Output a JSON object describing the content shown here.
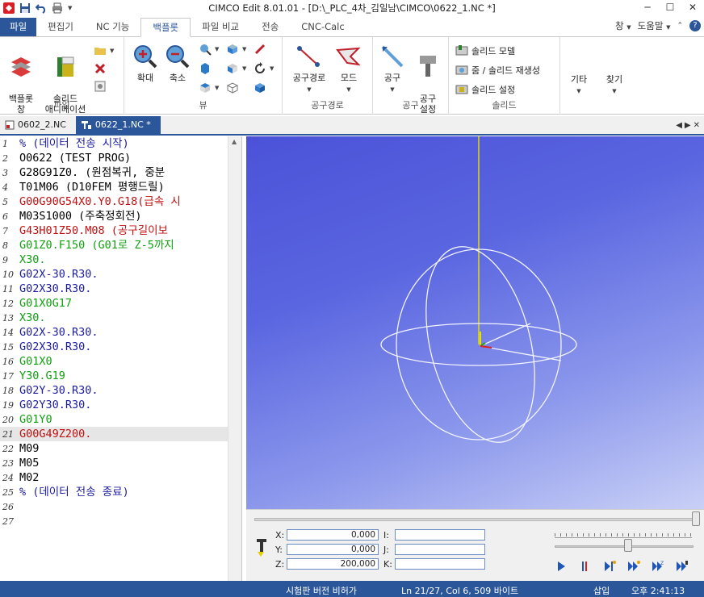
{
  "window": {
    "title": "CIMCO Edit 8.01.01 - [D:\\_PLC_4차_김일남\\CIMCO\\0622_1.NC *]"
  },
  "ribbon_tabs": [
    "파일",
    "편집기",
    "NC 기능",
    "백플롯",
    "파일 비교",
    "전송",
    "CNC-Calc"
  ],
  "ribbon_right": {
    "window": "창",
    "help": "도움말"
  },
  "ribbon": {
    "backplot_window": "백플롯\n창",
    "solid_animation": "솔리드\n애니메이션",
    "group_file": "파일",
    "zoom_in": "확대",
    "zoom_out": "축소",
    "group_view": "뷰",
    "toolpath": "공구경로",
    "mode": "모드",
    "group_toolpath": "공구경로",
    "tool": "공구",
    "tool_setup": "공구\n설정",
    "group_tool": "공구",
    "solid_model": "솔리드 모델",
    "zoom_regen": "줌 / 솔리드 재생성",
    "solid_setup": "솔리드 설정",
    "group_solid": "솔리드",
    "etc": "기타",
    "find": "찾기"
  },
  "doc_tabs": [
    {
      "label": "0602_2.NC"
    },
    {
      "label": "0622_1.NC *"
    }
  ],
  "code_lines": [
    {
      "n": "1",
      "text": "% (데이터 전송 시작)",
      "color": "#1c1ca0"
    },
    {
      "n": "2",
      "text": "O0622 (TEST PROG)",
      "color": "#000000"
    },
    {
      "n": "3",
      "text": "G28G91Z0. (원점복귀, 중분",
      "color": "#000000"
    },
    {
      "n": "4",
      "text": "T01M06 (D10FEM 평행드릴)",
      "color": "#000000"
    },
    {
      "n": "5",
      "text": "G00G90G54X0.Y0.G18(급속 시",
      "color": "#c01010"
    },
    {
      "n": "6",
      "text": "M03S1000 (주축정회전)",
      "color": "#000000"
    },
    {
      "n": "7",
      "text": "G43H01Z50.M08 (공구길이보",
      "color": "#c01010"
    },
    {
      "n": "8",
      "text": "G01Z0.F150 (G01로 Z-5까지",
      "color": "#10a010"
    },
    {
      "n": "9",
      "text": "X30.",
      "color": "#10a010"
    },
    {
      "n": "10",
      "text": "G02X-30.R30.",
      "color": "#1c1ca0"
    },
    {
      "n": "11",
      "text": "G02X30.R30.",
      "color": "#1c1ca0"
    },
    {
      "n": "12",
      "text": "G01X0G17",
      "color": "#10a010"
    },
    {
      "n": "13",
      "text": "X30.",
      "color": "#10a010"
    },
    {
      "n": "14",
      "text": "G02X-30.R30.",
      "color": "#1c1ca0"
    },
    {
      "n": "15",
      "text": "G02X30.R30.",
      "color": "#1c1ca0"
    },
    {
      "n": "16",
      "text": "G01X0",
      "color": "#10a010"
    },
    {
      "n": "17",
      "text": "Y30.G19",
      "color": "#10a010"
    },
    {
      "n": "18",
      "text": "G02Y-30.R30.",
      "color": "#1c1ca0"
    },
    {
      "n": "19",
      "text": "G02Y30.R30.",
      "color": "#1c1ca0"
    },
    {
      "n": "20",
      "text": "G01Y0",
      "color": "#10a010"
    },
    {
      "n": "21",
      "text": "G00G49Z200.",
      "color": "#c01010",
      "current": true
    },
    {
      "n": "22",
      "text": "M09",
      "color": "#000000"
    },
    {
      "n": "23",
      "text": "M05",
      "color": "#000000"
    },
    {
      "n": "24",
      "text": "M02",
      "color": "#000000"
    },
    {
      "n": "25",
      "text": "% (데이터 전송 종료)",
      "color": "#1c1ca0"
    },
    {
      "n": "26",
      "text": "",
      "color": "#000000"
    },
    {
      "n": "27",
      "text": "",
      "color": "#000000"
    }
  ],
  "coords": {
    "x_label": "X:",
    "x_value": "0,000",
    "y_label": "Y:",
    "y_value": "0,000",
    "z_label": "Z:",
    "z_value": "200,000",
    "i_label": "I:",
    "j_label": "J:",
    "k_label": "K:"
  },
  "status": {
    "trial": "시험판 버전 비허가",
    "position": "Ln 21/27, Col 6, 509 바이트",
    "mode": "삽입",
    "time": "오후 2:41:13"
  },
  "colors": {
    "accent": "#2b579a",
    "viewport_top": "#4b52d8",
    "viewport_bottom": "#c9d0f6"
  }
}
